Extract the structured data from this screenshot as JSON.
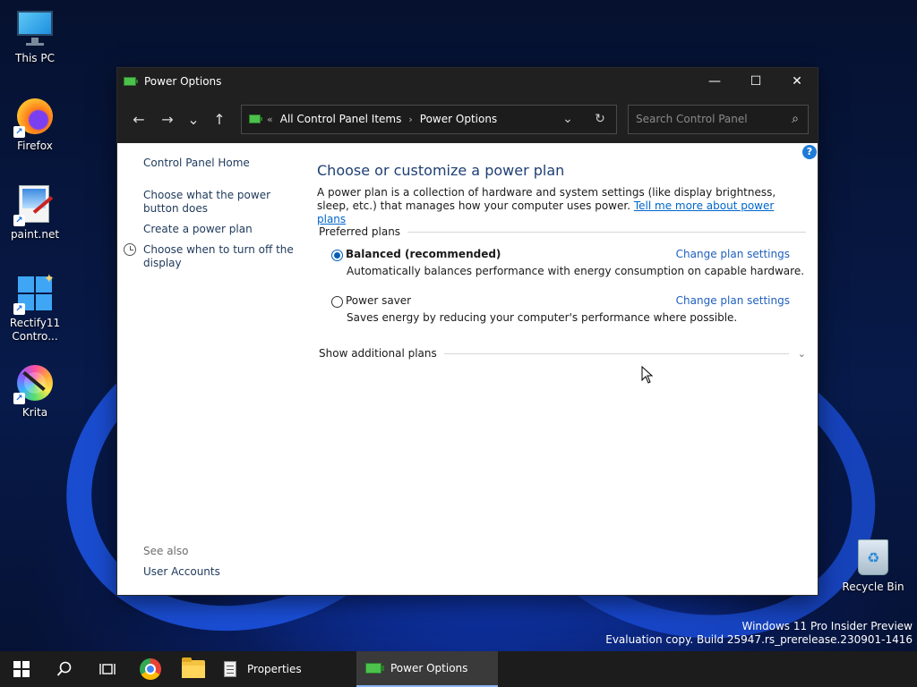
{
  "desktop": {
    "icons": [
      {
        "label": "This PC"
      },
      {
        "label": "Firefox"
      },
      {
        "label": "paint.net"
      },
      {
        "label": "Rectify11\nContro..."
      },
      {
        "label": "Krita"
      }
    ],
    "recycle_bin": "Recycle Bin",
    "watermark_line1": "Windows 11 Pro Insider Preview",
    "watermark_line2": "Evaluation copy. Build 25947.rs_prerelease.230901-1416"
  },
  "window": {
    "title": "Power Options",
    "minimize": "—",
    "maximize": "☐",
    "close": "✕"
  },
  "nav": {
    "back": "←",
    "forward": "→",
    "recent": "⌄",
    "up": "↑",
    "breadcrumb_prefix": "«",
    "breadcrumb_1": "All Control Panel Items",
    "breadcrumb_sep": "›",
    "breadcrumb_2": "Power Options",
    "dropdown": "⌄",
    "refresh": "↻",
    "search_placeholder": "Search Control Panel",
    "search_icon": "⌕"
  },
  "sidebar": {
    "home": "Control Panel Home",
    "power_button": "Choose what the power button does",
    "create_plan": "Create a power plan",
    "turn_off_display": "Choose when to turn off the display",
    "see_also": "See also",
    "user_accounts": "User Accounts"
  },
  "main": {
    "help": "?",
    "title": "Choose or customize a power plan",
    "intro": "A power plan is a collection of hardware and system settings (like display brightness, sleep, etc.) that manages how your computer uses power. ",
    "intro_link": "Tell me more about power plans",
    "preferred_plans": "Preferred plans",
    "plans": [
      {
        "name": "Balanced (recommended)",
        "desc": "Automatically balances performance with energy consumption on capable hardware.",
        "change": "Change plan settings",
        "selected": true
      },
      {
        "name": "Power saver",
        "desc": "Saves energy by reducing your computer's performance where possible.",
        "change": "Change plan settings",
        "selected": false
      }
    ],
    "show_additional": "Show additional plans"
  },
  "taskbar": {
    "start": "start-icon",
    "search": "⌕",
    "task_view": "task-view-icon",
    "properties": "Properties",
    "power_options": "Power Options"
  }
}
